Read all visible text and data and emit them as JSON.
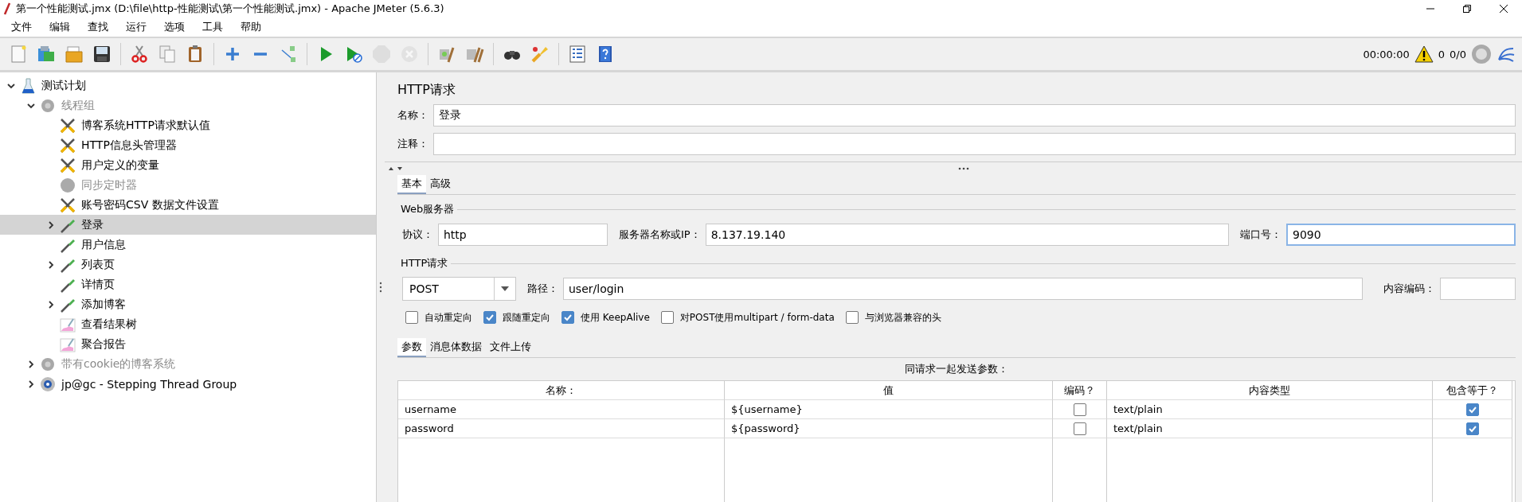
{
  "window": {
    "title": "第一个性能测试.jmx (D:\\file\\http-性能测试\\第一个性能测试.jmx) - Apache JMeter (5.6.3)"
  },
  "menu": [
    "文件",
    "编辑",
    "查找",
    "运行",
    "选项",
    "工具",
    "帮助"
  ],
  "toolbar": [
    {
      "kind": "new",
      "disabled": false
    },
    {
      "kind": "templates",
      "disabled": false
    },
    {
      "kind": "open",
      "disabled": false
    },
    {
      "kind": "save",
      "disabled": false
    },
    {
      "kind": "separator"
    },
    {
      "kind": "cut",
      "disabled": false
    },
    {
      "kind": "copy",
      "disabled": false
    },
    {
      "kind": "paste",
      "disabled": false
    },
    {
      "kind": "separator"
    },
    {
      "kind": "expand",
      "disabled": false
    },
    {
      "kind": "collapse",
      "disabled": false
    },
    {
      "kind": "toggle",
      "disabled": false
    },
    {
      "kind": "separator"
    },
    {
      "kind": "start",
      "disabled": false
    },
    {
      "kind": "start-no-timers",
      "disabled": false
    },
    {
      "kind": "stop",
      "disabled": true
    },
    {
      "kind": "shutdown",
      "disabled": true
    },
    {
      "kind": "separator"
    },
    {
      "kind": "clear",
      "disabled": false
    },
    {
      "kind": "clear-all",
      "disabled": false
    },
    {
      "kind": "separator"
    },
    {
      "kind": "search",
      "disabled": false
    },
    {
      "kind": "reset-search",
      "disabled": false
    },
    {
      "kind": "separator"
    },
    {
      "kind": "function-helper",
      "disabled": false
    },
    {
      "kind": "help",
      "disabled": false
    }
  ],
  "status": {
    "elapsed": "00:00:00",
    "warnings": "0",
    "threads": "0/0"
  },
  "tree": [
    {
      "label": "测试计划",
      "kind": "plan",
      "expanded": true,
      "selected": false,
      "disabled": false,
      "children": [
        {
          "label": "线程组",
          "kind": "thread-group",
          "expanded": true,
          "selected": false,
          "disabled": true,
          "children": [
            {
              "label": "博客系统HTTP请求默认值",
              "kind": "config",
              "selected": false,
              "disabled": false
            },
            {
              "label": "HTTP信息头管理器",
              "kind": "config",
              "selected": false,
              "disabled": false
            },
            {
              "label": "用户定义的变量",
              "kind": "config",
              "selected": false,
              "disabled": false
            },
            {
              "label": "同步定时器",
              "kind": "timer",
              "selected": false,
              "disabled": true
            },
            {
              "label": "账号密码CSV 数据文件设置",
              "kind": "config",
              "selected": false,
              "disabled": false
            },
            {
              "label": "登录",
              "kind": "sampler",
              "expanded": false,
              "selected": true,
              "disabled": false
            },
            {
              "label": "用户信息",
              "kind": "sampler",
              "selected": false,
              "disabled": false
            },
            {
              "label": "列表页",
              "kind": "sampler",
              "expanded": false,
              "selected": false,
              "disabled": false
            },
            {
              "label": "详情页",
              "kind": "sampler",
              "selected": false,
              "disabled": false
            },
            {
              "label": "添加博客",
              "kind": "sampler",
              "expanded": false,
              "selected": false,
              "disabled": false
            },
            {
              "label": "查看结果树",
              "kind": "listener",
              "selected": false,
              "disabled": false
            },
            {
              "label": "聚合报告",
              "kind": "listener",
              "selected": false,
              "disabled": false
            }
          ]
        },
        {
          "label": "带有cookie的博客系统",
          "kind": "thread-group",
          "expanded": false,
          "selected": false,
          "disabled": true
        },
        {
          "label": "jp@gc - Stepping Thread Group",
          "kind": "stepping",
          "expanded": false,
          "selected": false,
          "disabled": false
        }
      ]
    }
  ],
  "sampler": {
    "title": "HTTP请求",
    "name": {
      "label": "名称：",
      "value": "登录"
    },
    "comment": {
      "label": "注释："
    },
    "tabs": [
      {
        "label": "基本",
        "selected": true
      },
      {
        "label": "高级",
        "selected": false
      }
    ],
    "web_server": {
      "legend": "Web服务器",
      "fields": [
        {
          "label": "协议：",
          "value": "http",
          "focused": false
        },
        {
          "label": "服务器名称或IP：",
          "value": "8.137.19.140",
          "focused": false
        },
        {
          "label": "端口号：",
          "value": "9090",
          "focused": true
        }
      ]
    },
    "http_request": {
      "legend": "HTTP请求",
      "method": "POST",
      "path": {
        "label": "路径：",
        "value": "user/login"
      },
      "encoding": {
        "label": "内容编码："
      },
      "options": [
        {
          "label": "自动重定向",
          "checked": false
        },
        {
          "label": "跟随重定向",
          "checked": true
        },
        {
          "label": "使用 KeepAlive",
          "checked": true
        },
        {
          "label": "对POST使用multipart / form-data",
          "checked": false
        },
        {
          "label": "与浏览器兼容的头",
          "checked": false
        }
      ]
    },
    "sub_tabs": [
      {
        "label": "参数",
        "selected": true
      },
      {
        "label": "消息体数据",
        "selected": false
      },
      {
        "label": "文件上传",
        "selected": false
      }
    ],
    "parameters": {
      "caption": "同请求一起发送参数：",
      "columns": [
        "名称：",
        "值",
        "编码？",
        "内容类型",
        "包含等于？"
      ],
      "rows": [
        {
          "name": "username",
          "value": "${username}",
          "encode": false,
          "content_type": "text/plain",
          "include_equals": true
        },
        {
          "name": "password",
          "value": "${password}",
          "encode": false,
          "content_type": "text/plain",
          "include_equals": true
        }
      ]
    }
  }
}
